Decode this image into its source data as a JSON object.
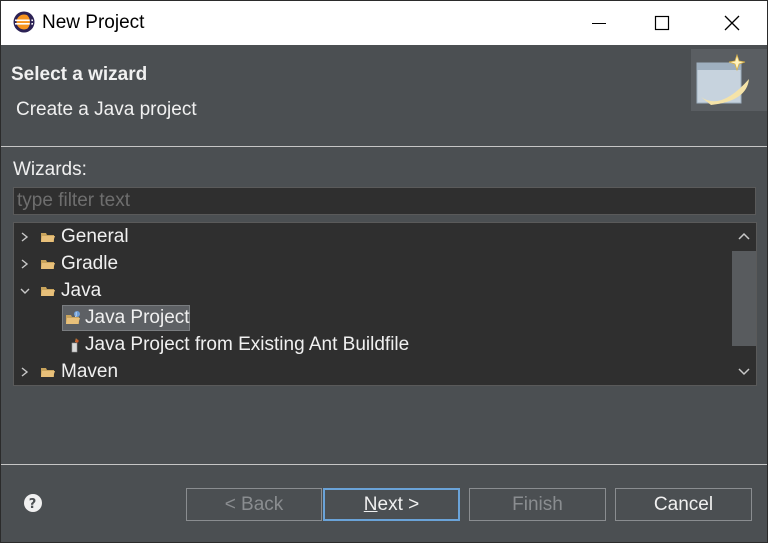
{
  "window": {
    "title": "New Project",
    "icon": "eclipse-icon",
    "controls": {
      "minimize": "minimize-icon",
      "maximize": "maximize-icon",
      "close": "close-icon"
    }
  },
  "banner": {
    "heading": "Select a wizard",
    "description": "Create a Java project",
    "image": "new-wizard-banner-icon"
  },
  "wizards": {
    "label": "Wizards:",
    "filter_placeholder": "type filter text",
    "filter_value": "",
    "tree": [
      {
        "label": "General",
        "level": 0,
        "expanded": false,
        "icon": "folder-icon"
      },
      {
        "label": "Gradle",
        "level": 0,
        "expanded": false,
        "icon": "folder-icon"
      },
      {
        "label": "Java",
        "level": 0,
        "expanded": true,
        "icon": "folder-icon"
      },
      {
        "label": "Java Project",
        "level": 1,
        "selected": true,
        "icon": "java-project-icon"
      },
      {
        "label": "Java Project from Existing Ant Buildfile",
        "level": 1,
        "icon": "ant-buildfile-icon"
      },
      {
        "label": "Maven",
        "level": 0,
        "expanded": false,
        "icon": "folder-icon"
      }
    ]
  },
  "buttons": {
    "help_icon": "help-icon",
    "back": "< Back",
    "next_mnemonic": "N",
    "next_rest": "ext >",
    "finish": "Finish",
    "cancel": "Cancel"
  },
  "colors": {
    "background": "#4b4f52",
    "tree_background": "#2f2f2f",
    "default_button_border": "#6aa3d8",
    "folder": "#e8c07a"
  }
}
